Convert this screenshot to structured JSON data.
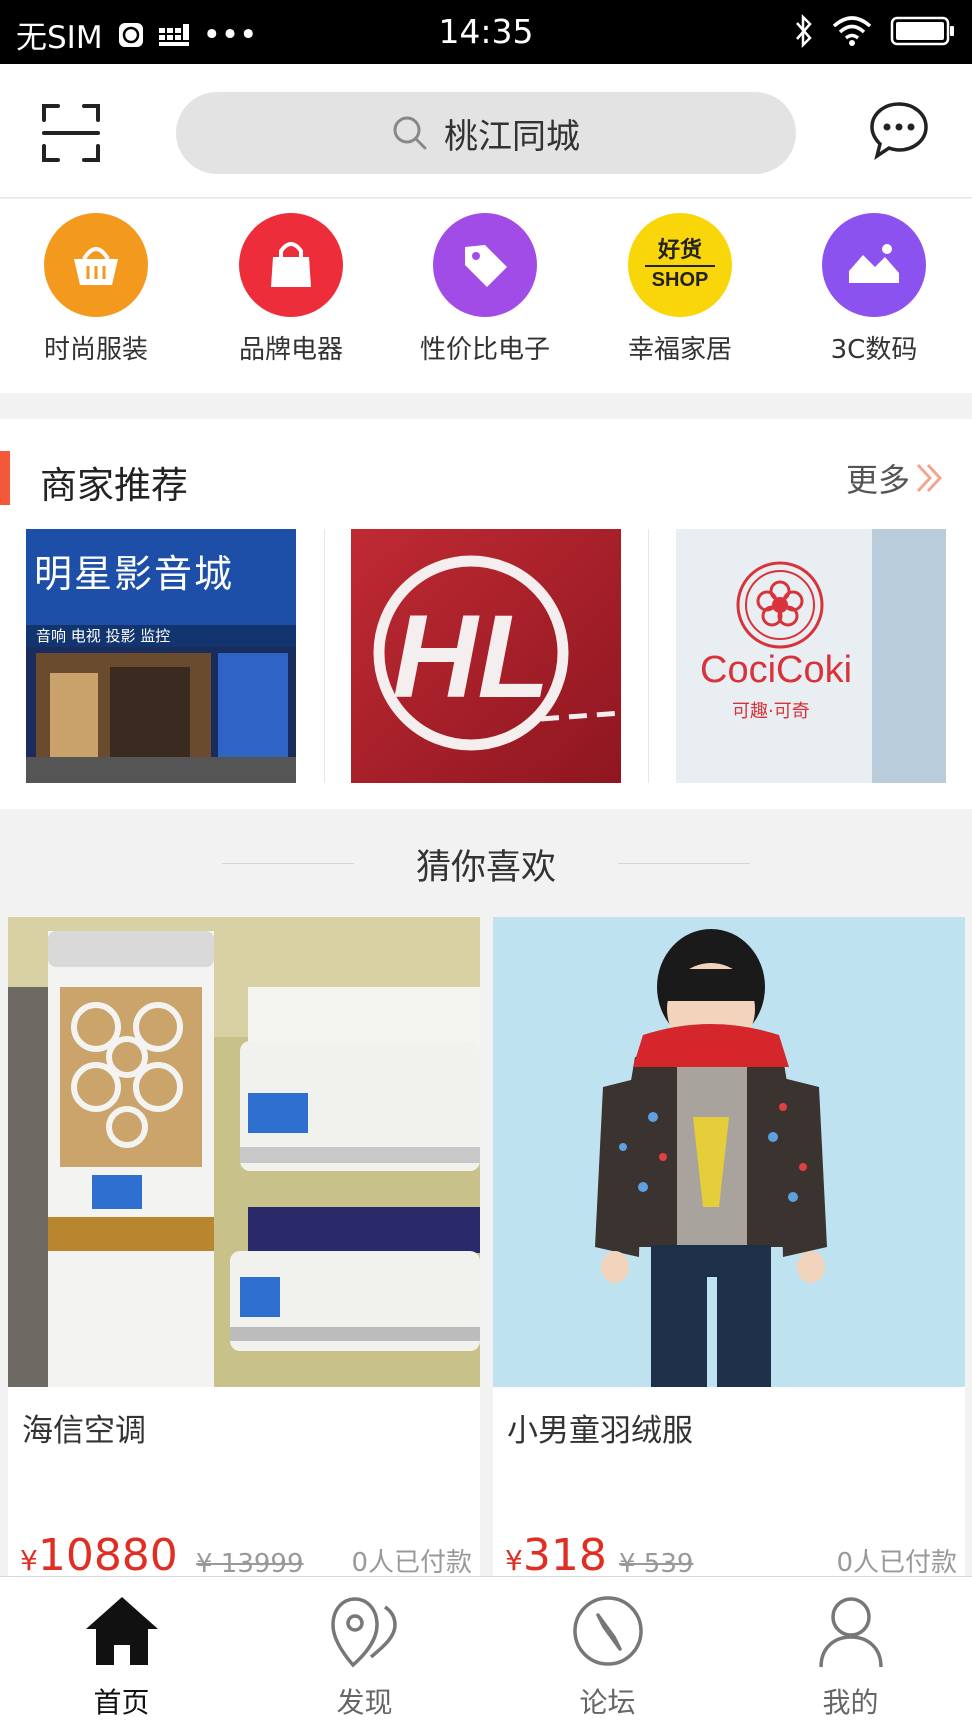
{
  "status_bar": {
    "carrier": "无SIM",
    "dots": "•••",
    "time": "14:35"
  },
  "header": {
    "search_text": "桃江同城",
    "icons": [
      "scan-icon",
      "search-icon",
      "message-icon"
    ]
  },
  "categories": [
    {
      "label": "时尚服装",
      "icon": "basket-icon",
      "color": "#f39a1e"
    },
    {
      "label": "品牌电器",
      "icon": "shopping-bag-icon",
      "color": "#ee2d3a"
    },
    {
      "label": "性价比电子",
      "icon": "tag-icon",
      "color": "#a24ce8"
    },
    {
      "label": "幸福家居",
      "icon": "shop-badge-icon",
      "color": "#f9d60a",
      "badge_top": "好货",
      "badge_bottom": "SHOP"
    },
    {
      "label": "3C数码",
      "icon": "landscape-icon",
      "color": "#8b52f0"
    }
  ],
  "merchants": {
    "title": "商家推荐",
    "more_label": "更多",
    "shops": [
      {
        "sign_text": "明星影音城",
        "sub_text": "音响 电视 投影 监控"
      },
      {
        "logo_text": "HL"
      },
      {
        "logo_text": "CociCoki",
        "logo_sub": "可趣·可奇"
      }
    ]
  },
  "guess": {
    "title": "猜你喜欢",
    "products": [
      {
        "name": "海信空调",
        "currency": "¥",
        "price": "10880",
        "original_price": "¥ 13999",
        "paid": "0人已付款"
      },
      {
        "name": "小男童羽绒服",
        "currency": "¥",
        "price": "318",
        "original_price": "¥ 539",
        "paid": "0人已付款"
      }
    ]
  },
  "tabbar": {
    "tabs": [
      {
        "label": "首页",
        "icon": "home-icon",
        "active": true
      },
      {
        "label": "发现",
        "icon": "map-pin-icon",
        "active": false
      },
      {
        "label": "论坛",
        "icon": "compass-icon",
        "active": false
      },
      {
        "label": "我的",
        "icon": "user-icon",
        "active": false
      }
    ]
  },
  "colors": {
    "accent": "#f4583a",
    "price": "#e02e24"
  }
}
